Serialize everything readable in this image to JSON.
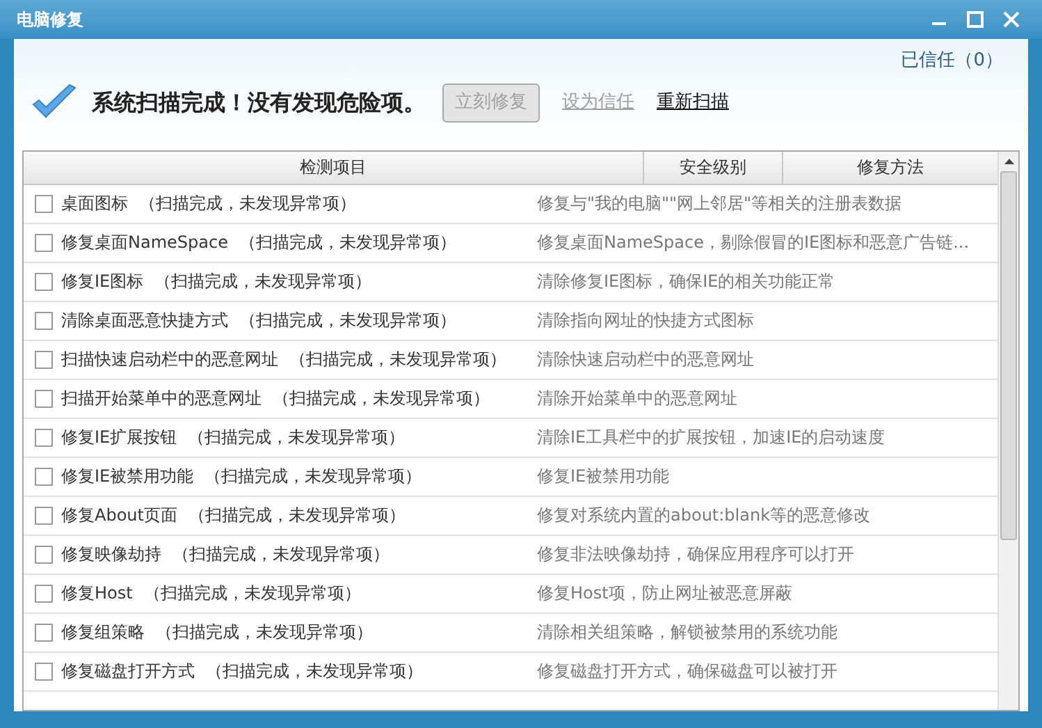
{
  "window": {
    "title": "电脑修复"
  },
  "trusted": "已信任（0）",
  "status": "系统扫描完成！没有发现危险项。",
  "actions": [
    {
      "kind": "button",
      "label": "立刻修复",
      "disabled": true
    },
    {
      "kind": "link",
      "label": "设为信任",
      "disabled": true
    },
    {
      "kind": "link",
      "label": "重新扫描",
      "disabled": false
    }
  ],
  "table": {
    "columns": [
      "检测项目",
      "安全级别",
      "修复方法"
    ],
    "rows": [
      {
        "checked": false,
        "item": "桌面图标",
        "status": "（扫描完成，未发现异常项）",
        "method": "修复与\"我的电脑\"\"网上邻居\"等相关的注册表数据"
      },
      {
        "checked": false,
        "item": "修复桌面NameSpace",
        "status": "（扫描完成，未发现异常项）",
        "method": "修复桌面NameSpace，剔除假冒的IE图标和恶意广告链..."
      },
      {
        "checked": false,
        "item": "修复IE图标",
        "status": "（扫描完成，未发现异常项）",
        "method": "清除修复IE图标，确保IE的相关功能正常"
      },
      {
        "checked": false,
        "item": "清除桌面恶意快捷方式",
        "status": "（扫描完成，未发现异常项）",
        "method": "清除指向网址的快捷方式图标"
      },
      {
        "checked": false,
        "item": "扫描快速启动栏中的恶意网址",
        "status": "（扫描完成，未发现异常项）",
        "method": "清除快速启动栏中的恶意网址"
      },
      {
        "checked": false,
        "item": "扫描开始菜单中的恶意网址",
        "status": "（扫描完成，未发现异常项）",
        "method": "清除开始菜单中的恶意网址"
      },
      {
        "checked": false,
        "item": "修复IE扩展按钮",
        "status": "（扫描完成，未发现异常项）",
        "method": "清除IE工具栏中的扩展按钮，加速IE的启动速度"
      },
      {
        "checked": false,
        "item": "修复IE被禁用功能",
        "status": "（扫描完成，未发现异常项）",
        "method": "修复IE被禁用功能"
      },
      {
        "checked": false,
        "item": "修复About页面",
        "status": "（扫描完成，未发现异常项）",
        "method": "修复对系统内置的about:blank等的恶意修改"
      },
      {
        "checked": false,
        "item": "修复映像劫持",
        "status": "（扫描完成，未发现异常项）",
        "method": "修复非法映像劫持，确保应用程序可以打开"
      },
      {
        "checked": false,
        "item": "修复Host",
        "status": "（扫描完成，未发现异常项）",
        "method": "修复Host项，防止网址被恶意屏蔽"
      },
      {
        "checked": false,
        "item": "修复组策略",
        "status": "（扫描完成，未发现异常项）",
        "method": "清除相关组策略，解锁被禁用的系统功能"
      },
      {
        "checked": false,
        "item": "修复磁盘打开方式",
        "status": "（扫描完成，未发现异常项）",
        "method": "修复磁盘打开方式，确保磁盘可以被打开"
      }
    ]
  }
}
